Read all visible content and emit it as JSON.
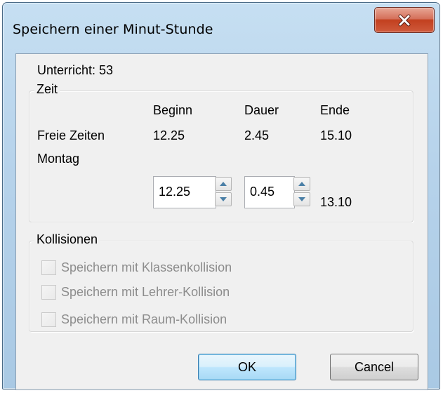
{
  "window": {
    "title": "Speichern einer Minut-Stunde",
    "close_label": "×"
  },
  "lesson": {
    "label": "Unterricht: 53"
  },
  "zeit": {
    "legend": "Zeit",
    "headers": {
      "begin": "Beginn",
      "duration": "Dauer",
      "end": "Ende"
    },
    "free_times_label": "Freie Zeiten",
    "day_label": "Montag",
    "free": {
      "begin": "12.25",
      "duration": "2.45",
      "end": "15.10"
    },
    "input": {
      "begin": "12.25",
      "duration": "0.45",
      "end": "13.10"
    }
  },
  "collisions": {
    "legend": "Kollisionen",
    "options": [
      {
        "label": "Speichern mit Klassenkollision",
        "checked": false,
        "enabled": false
      },
      {
        "label": "Speichern mit Lehrer-Kollision",
        "checked": false,
        "enabled": false
      },
      {
        "label": "Speichern mit Raum-Kollision",
        "checked": false,
        "enabled": false
      }
    ]
  },
  "buttons": {
    "ok": "OK",
    "cancel": "Cancel"
  },
  "icons": {
    "close": "close-icon",
    "spin_up": "chevron-up-icon",
    "spin_down": "chevron-down-icon"
  },
  "colors": {
    "title_bar": "#b7d3eb",
    "close_button": "#c2401f",
    "dialog_bg": "#f0f0f0",
    "disabled_text": "#8c8c8c",
    "default_button_border": "#3c7fb1"
  }
}
